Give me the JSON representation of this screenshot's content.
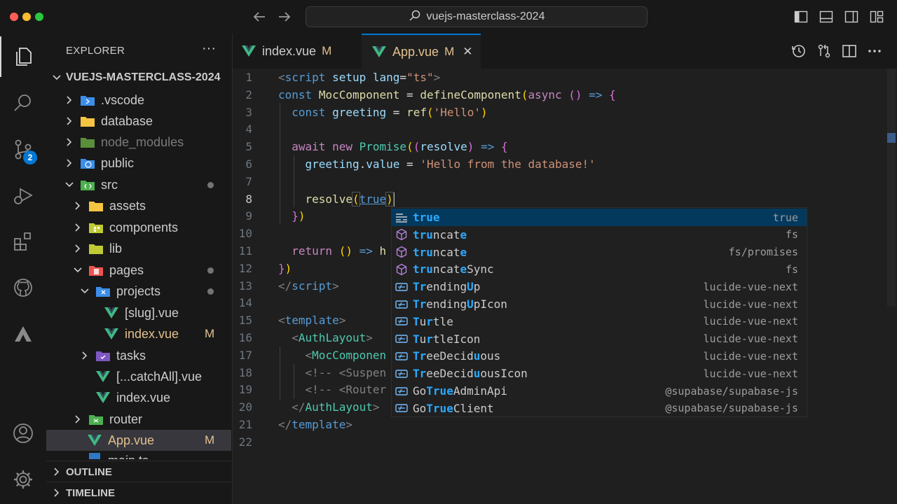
{
  "window": {
    "search_text": "vuejs-masterclass-2024"
  },
  "activity": {
    "source_control_badge": "2"
  },
  "explorer": {
    "title": "EXPLORER",
    "more": "···",
    "root": "VUEJS-MASTERCLASS-2024",
    "items": [
      {
        "label": ".vscode"
      },
      {
        "label": "database"
      },
      {
        "label": "node_modules"
      },
      {
        "label": "public"
      },
      {
        "label": "src"
      },
      {
        "label": "assets"
      },
      {
        "label": "components"
      },
      {
        "label": "lib"
      },
      {
        "label": "pages"
      },
      {
        "label": "projects"
      },
      {
        "label": "[slug].vue"
      },
      {
        "label": "index.vue",
        "status": "M"
      },
      {
        "label": "tasks"
      },
      {
        "label": "[...catchAll].vue"
      },
      {
        "label": "index.vue"
      },
      {
        "label": "router"
      },
      {
        "label": "App.vue",
        "status": "M"
      },
      {
        "label": "main.ts"
      }
    ],
    "outline": "OUTLINE",
    "timeline": "TIMELINE"
  },
  "tabs": [
    {
      "label": "index.vue",
      "status": "M"
    },
    {
      "label": "App.vue",
      "status": "M",
      "close": "✕"
    }
  ],
  "editor": {
    "line_numbers": [
      "1",
      "2",
      "3",
      "4",
      "5",
      "6",
      "7",
      "8",
      "9",
      "10",
      "11",
      "12",
      "13",
      "14",
      "15",
      "16",
      "17",
      "18",
      "19",
      "20",
      "21",
      "22"
    ],
    "current_line": 8
  },
  "suggestions": [
    {
      "label": "true",
      "detail": "true",
      "kind": "keyword"
    },
    {
      "label": "truncate",
      "detail": "fs",
      "kind": "method"
    },
    {
      "label": "truncate",
      "detail": "fs/promises",
      "kind": "method"
    },
    {
      "label": "truncateSync",
      "detail": "fs",
      "kind": "method"
    },
    {
      "label": "TrendingUp",
      "detail": "lucide-vue-next",
      "kind": "variable"
    },
    {
      "label": "TrendingUpIcon",
      "detail": "lucide-vue-next",
      "kind": "variable"
    },
    {
      "label": "Turtle",
      "detail": "lucide-vue-next",
      "kind": "variable"
    },
    {
      "label": "TurtleIcon",
      "detail": "lucide-vue-next",
      "kind": "variable"
    },
    {
      "label": "TreeDeciduous",
      "detail": "lucide-vue-next",
      "kind": "variable"
    },
    {
      "label": "TreeDeciduousIcon",
      "detail": "lucide-vue-next",
      "kind": "variable"
    },
    {
      "label": "GoTrueAdminApi",
      "detail": "@supabase/supabase-js",
      "kind": "variable"
    },
    {
      "label": "GoTrueClient",
      "detail": "@supabase/supabase-js",
      "kind": "variable"
    }
  ],
  "colors": {
    "accent": "#0078d4",
    "modified": "#e2c08d",
    "vue_green": "#41b883"
  }
}
